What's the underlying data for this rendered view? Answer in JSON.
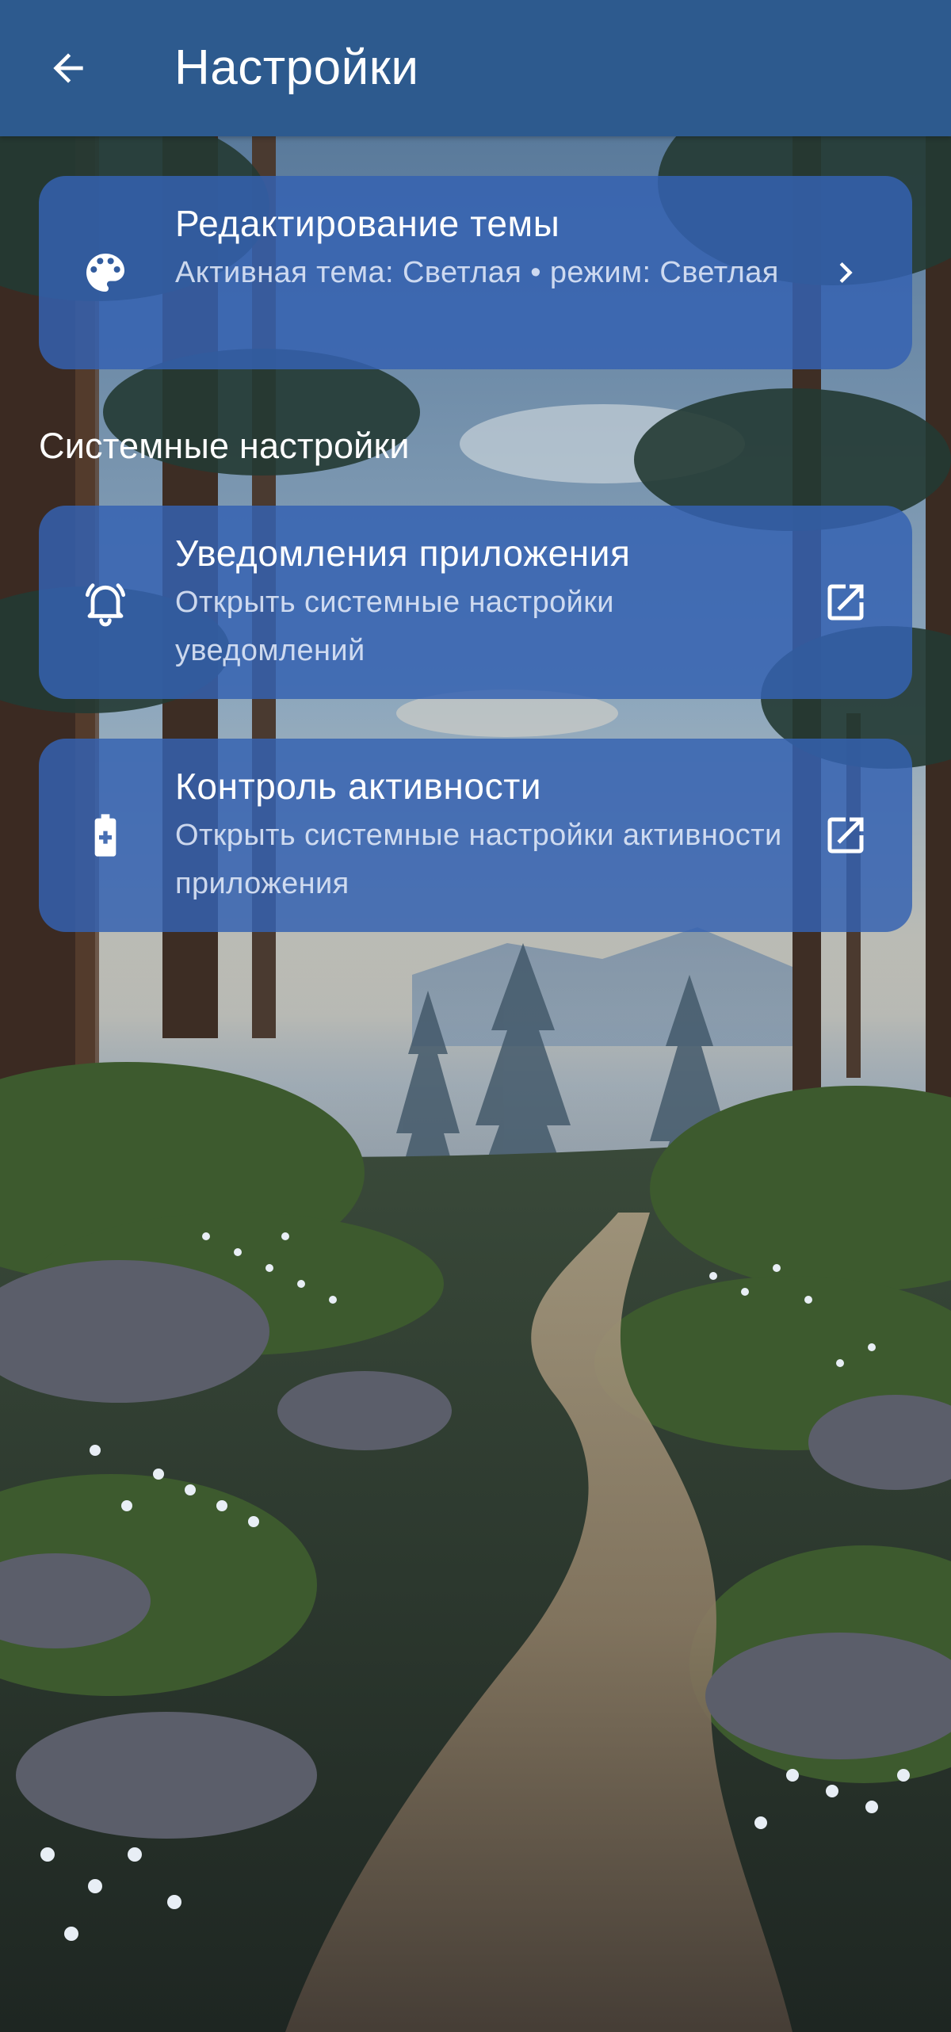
{
  "app_bar": {
    "title": "Настройки",
    "back_icon": "arrow-back-icon",
    "background": "#2d5a8e"
  },
  "theme_card": {
    "title": "Редактирование темы",
    "subtitle": "Активная тема: Светлая • режим: Светлая",
    "icon": "palette-icon",
    "trailing_icon": "chevron-right-icon"
  },
  "system_section": {
    "header": "Системные настройки",
    "items": [
      {
        "title": "Уведомления приложения",
        "subtitle": "Открыть системные настройки уведомлений",
        "icon": "bell-icon",
        "trailing_icon": "open-external-icon"
      },
      {
        "title": "Контроль активности",
        "subtitle": "Открыть системные настройки активности приложения",
        "icon": "battery-plus-icon",
        "trailing_icon": "open-external-icon"
      }
    ]
  },
  "colors": {
    "card_background": "#3462b2",
    "text_primary": "#ffffff",
    "text_secondary": "#e5ecfa"
  }
}
